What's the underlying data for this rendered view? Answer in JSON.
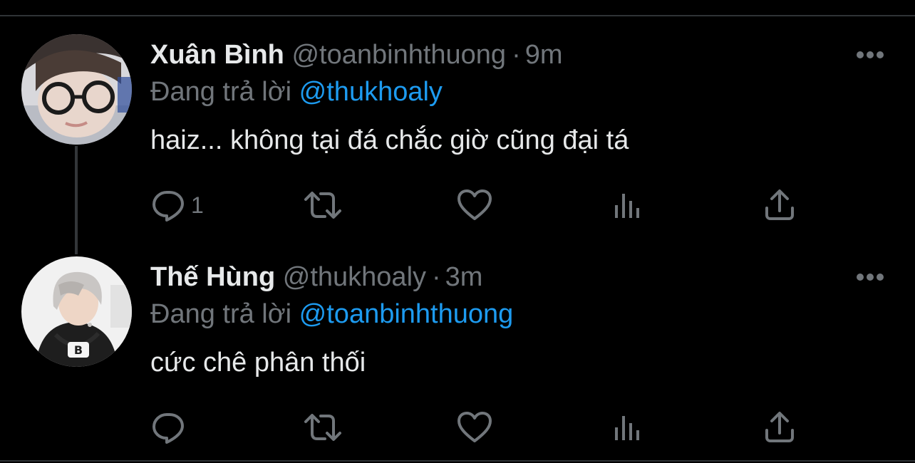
{
  "tweets": [
    {
      "display_name": "Xuân Bình",
      "handle": "@toanbinhthuong",
      "separator": "·",
      "time": "9m",
      "reply_prefix": "Đang trả lời",
      "reply_to": "@thukhoaly",
      "text": "haiz... không tại đá chắc giờ cũng đại tá",
      "reply_count": "1",
      "retweet_count": "",
      "like_count": ""
    },
    {
      "display_name": "Thế Hùng",
      "handle": "@thukhoaly",
      "separator": "·",
      "time": "3m",
      "reply_prefix": "Đang trả lời",
      "reply_to": "@toanbinhthuong",
      "text": "cức chê phân thối",
      "reply_count": "",
      "retweet_count": "",
      "like_count": ""
    }
  ],
  "icons": {
    "avatar_1": "avatar-boy-glasses-icon",
    "avatar_2": "avatar-silver-hair-hoodie-icon",
    "more": "more-horizontal-icon",
    "reply": "reply-bubble-icon",
    "retweet": "retweet-icon",
    "like": "heart-icon",
    "views": "views-bar-chart-icon",
    "share": "share-upload-icon"
  },
  "colors": {
    "background": "#000000",
    "primary_text": "#e7e9ea",
    "secondary_text": "#71767b",
    "accent": "#1d9bf0",
    "divider": "#2f3336"
  }
}
